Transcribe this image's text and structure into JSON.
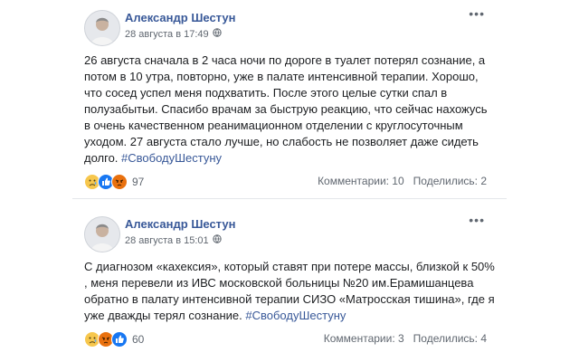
{
  "posts": [
    {
      "author": "Александр Шестун",
      "date": "28 августа в 17:49",
      "text": "26 августа сначала в 2 часа ночи по дороге в туалет потерял сознание, а потом в 10 утра, повторно, уже в палате интенсивной терапии. Хорошо, что сосед успел меня подхватить. После этого целые сутки спал в полузабытьи. Спасибо врачам за быструю реакцию, что сейчас нахожусь в очень качественном реанимационном отделении с круглосуточным уходом. 27 августа стало лучше, но слабость не позволяет даже сидеть долго.",
      "hashtag": "#СвободуШестуну",
      "reaction_icons": [
        "sad-reaction",
        "like-reaction",
        "angry-reaction"
      ],
      "reaction_count": "97",
      "comments": "Комментарии: 10",
      "shares": "Поделились: 2"
    },
    {
      "author": "Александр Шестун",
      "date": "28 августа в 15:01",
      "text": "С диагнозом «кахексия», который ставят при потере массы, близкой к 50% , меня перевели из ИВС московской больницы №20 им.Ерамишанцева обратно в палату интенсивной терапии СИЗО «Матросская тишина», где я уже дважды терял сознание.",
      "hashtag": "#СвободуШестуну",
      "reaction_icons": [
        "sad-reaction",
        "angry-reaction",
        "like-reaction"
      ],
      "reaction_count": "60",
      "comments": "Комментарии: 3",
      "shares": "Поделились: 4"
    }
  ],
  "more_glyph": "•••",
  "colors": {
    "link": "#385898",
    "meta": "#606770",
    "like": "#1877f2",
    "sad": "#f7c74d",
    "angry": "#e9710f"
  }
}
